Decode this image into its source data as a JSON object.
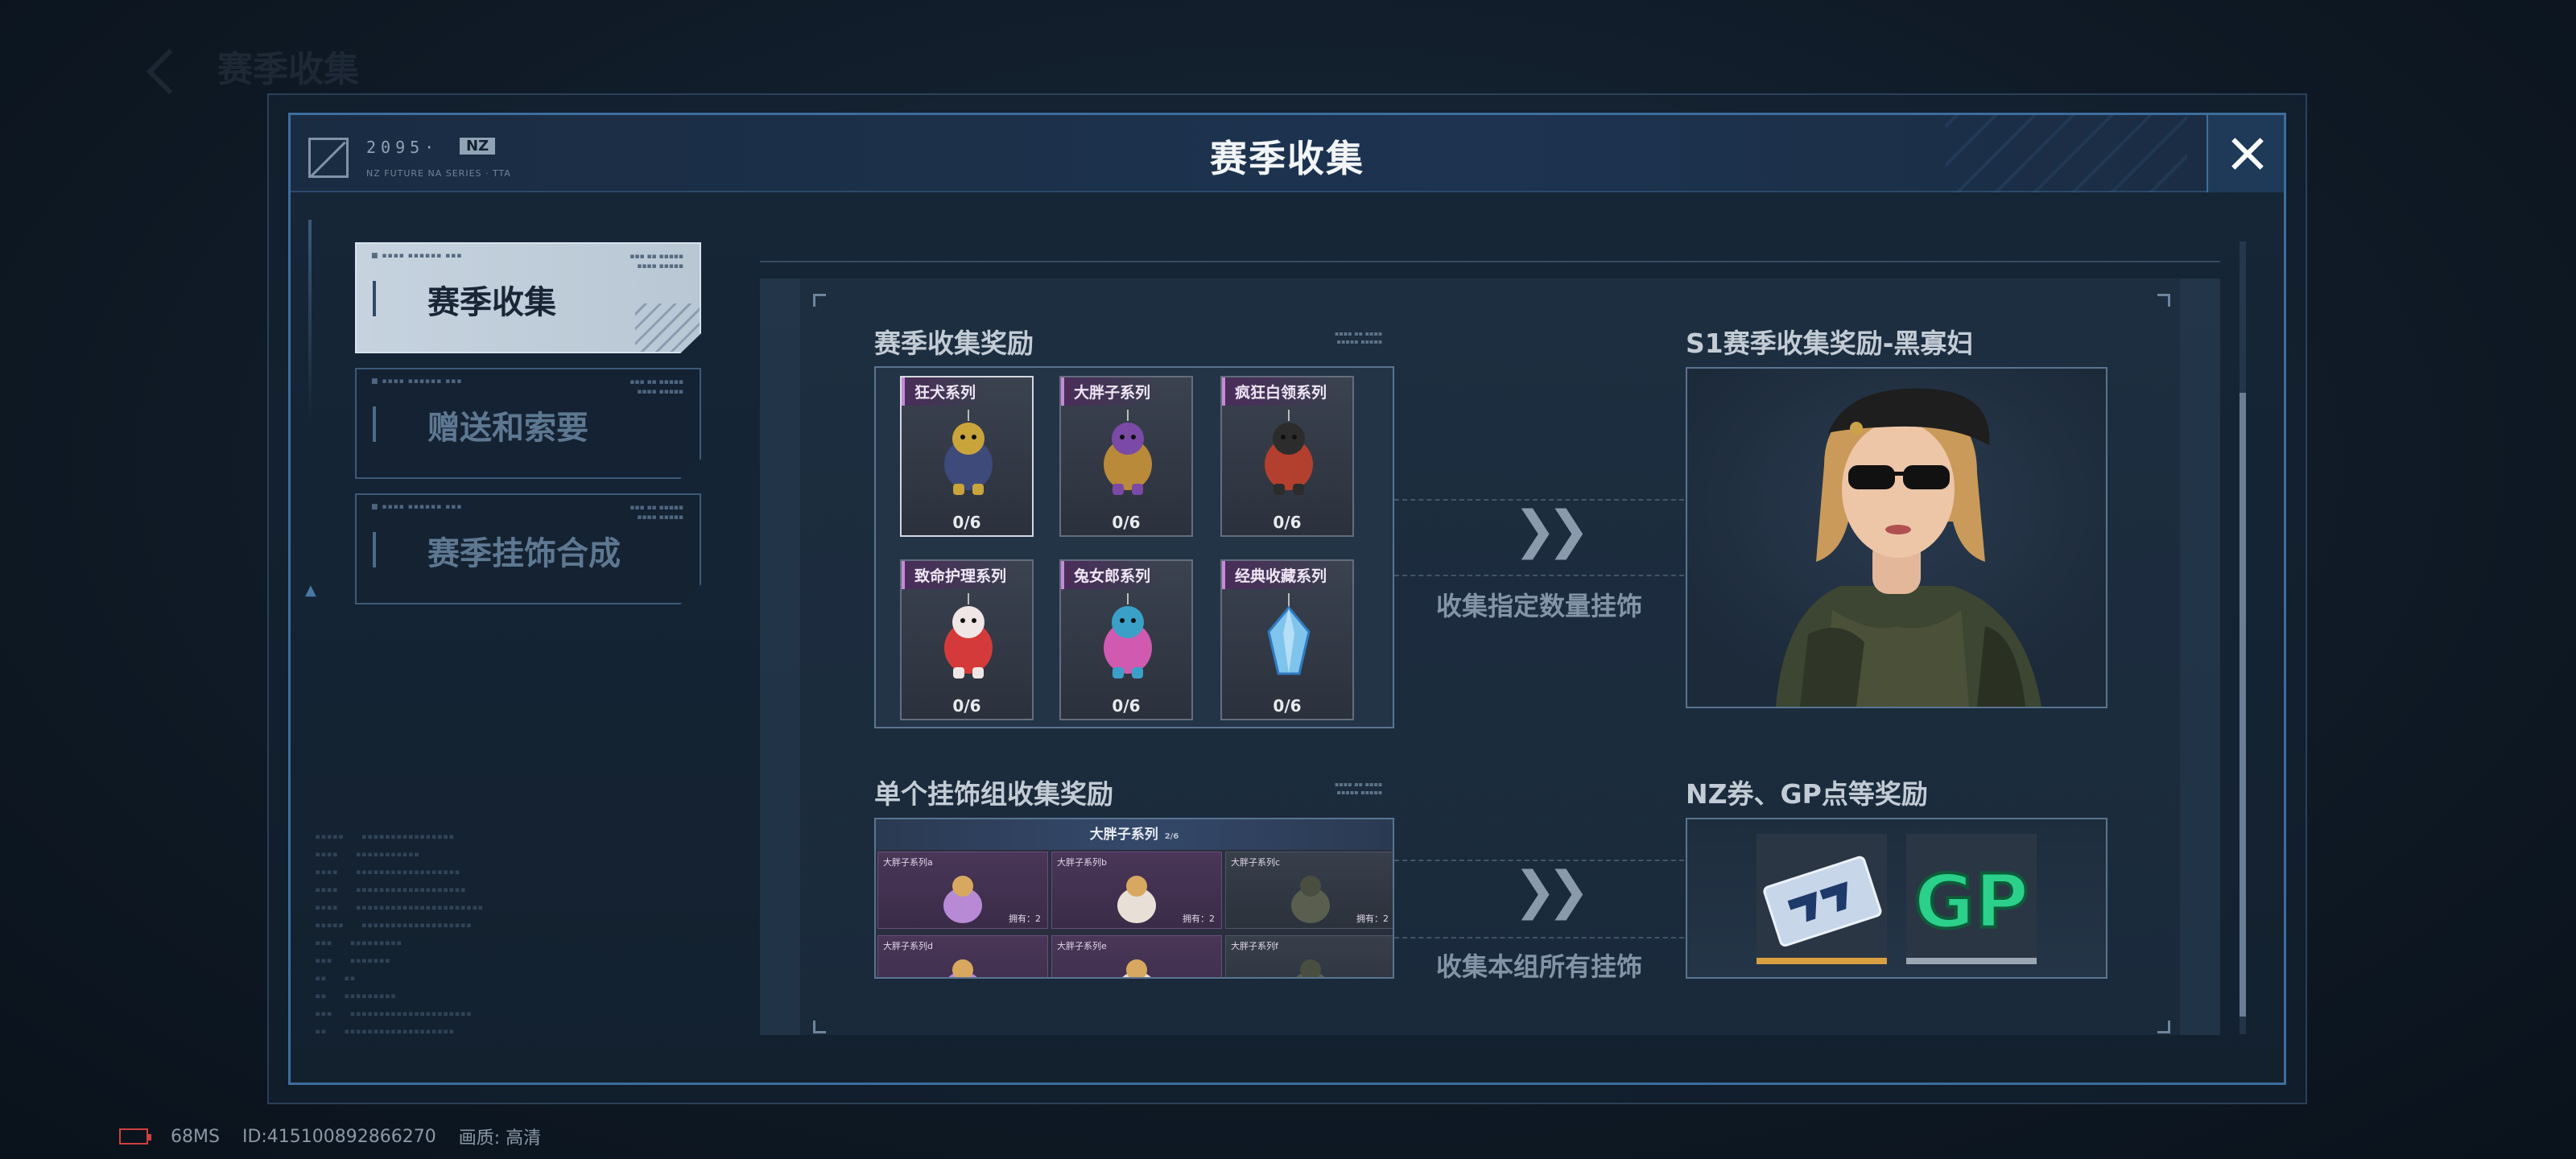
{
  "background": {
    "ghost_title": "赛季收集"
  },
  "header": {
    "logo_version": "2095·",
    "logo_tag": "NZ",
    "logo_subtitle": "NZ FUTURE NA SERIES · TTA",
    "title": "赛季收集",
    "close_icon": "close-icon"
  },
  "tabs": [
    {
      "label": "赛季收集",
      "active": true
    },
    {
      "label": "赠送和索要",
      "active": false
    },
    {
      "label": "赛季挂饰合成",
      "active": false
    }
  ],
  "collection": {
    "title": "赛季收集奖励",
    "items": [
      {
        "label": "狂犬系列",
        "count": "0/6",
        "icon": "mad-dog-charm-icon"
      },
      {
        "label": "大胖子系列",
        "count": "0/6",
        "icon": "big-fatty-charm-icon"
      },
      {
        "label": "疯狂白领系列",
        "count": "0/6",
        "icon": "crazy-clown-charm-icon"
      },
      {
        "label": "致命护理系列",
        "count": "0/6",
        "icon": "deadly-nurse-charm-icon"
      },
      {
        "label": "兔女郎系列",
        "count": "0/6",
        "icon": "bunny-girl-charm-icon"
      },
      {
        "label": "经典收藏系列",
        "count": "0/6",
        "icon": "crystal-charm-icon"
      }
    ],
    "hint": "收集指定数量挂饰",
    "reward_title": "S1赛季收集奖励-黑寡妇",
    "reward_icon": "black-widow-character-icon"
  },
  "single": {
    "title": "单个挂饰组收集奖励",
    "series_name": "大胖子系列",
    "series_count": "2/6",
    "cards": [
      {
        "label": "大胖子系列a",
        "count": "拥有：2",
        "style": "purple"
      },
      {
        "label": "大胖子系列b",
        "count": "拥有：2",
        "style": "purple"
      },
      {
        "label": "大胖子系列c",
        "count": "拥有：2",
        "style": "gray"
      },
      {
        "label": "大胖子系列d",
        "count": "",
        "style": "purple"
      },
      {
        "label": "大胖子系列e",
        "count": "",
        "style": "purple"
      },
      {
        "label": "大胖子系列f",
        "count": "",
        "style": "gray"
      }
    ],
    "hint": "收集本组所有挂饰",
    "reward_title": "NZ券、GP点等奖励",
    "rewards": [
      {
        "icon": "nz-ticket-icon"
      },
      {
        "icon": "gp-points-icon",
        "text": "GP"
      }
    ]
  },
  "status": {
    "battery_icon": "battery-icon",
    "ping": "68MS",
    "id": "ID:415100892866270",
    "quality_label": "画质:",
    "quality_value": "高清"
  },
  "colors": {
    "accent_blue": "#3d6d9c",
    "active_tab": "#c6d3df",
    "gp_green": "#2bd08a",
    "series_purple": "#c58ad8"
  }
}
